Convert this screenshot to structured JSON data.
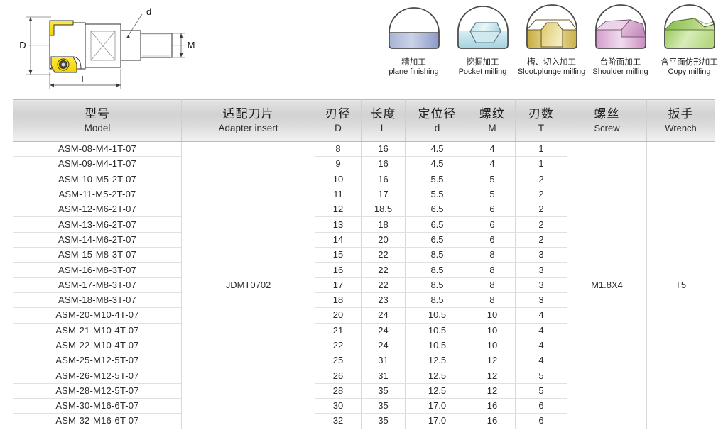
{
  "drawing": {
    "labels": {
      "diameter": "D",
      "length": "L",
      "pilot_diameter": "d",
      "thread": "M"
    }
  },
  "app_icons": [
    {
      "icon": "plane-finishing-icon",
      "label_cn": "精加工",
      "label_en": "plane finishing",
      "color": "#9aa7cf"
    },
    {
      "icon": "pocket-milling-icon",
      "label_cn": "挖掘加工",
      "label_en": "Pocket milling",
      "color": "#8fc6d9"
    },
    {
      "icon": "slot-plunge-milling-icon",
      "label_cn": "槽、切入加工",
      "label_en": "Sloot.plunge milling",
      "color": "#d3b445"
    },
    {
      "icon": "shoulder-milling-icon",
      "label_cn": "台阶面加工",
      "label_en": "Shoulder milling",
      "color": "#c98cc0"
    },
    {
      "icon": "copy-milling-icon",
      "label_cn": "含平面仿形加工",
      "label_en": "Copy milling",
      "color": "#9bc45a"
    }
  ],
  "table": {
    "headers": [
      {
        "cn": "型号",
        "en": "Model"
      },
      {
        "cn": "适配刀片",
        "en": "Adapter  insert"
      },
      {
        "cn": "刃径",
        "en": "D"
      },
      {
        "cn": "长度",
        "en": "L"
      },
      {
        "cn": "定位径",
        "en": "d"
      },
      {
        "cn": "螺纹",
        "en": "M"
      },
      {
        "cn": "刃数",
        "en": "T"
      },
      {
        "cn": "螺丝",
        "en": "Screw"
      },
      {
        "cn": "扳手",
        "en": "Wrench"
      }
    ],
    "merged": {
      "adapter_insert": "JDMT0702",
      "screw": "M1.8X4",
      "wrench": "T5"
    },
    "rows": [
      {
        "model": "ASM-08-M4-1T-07",
        "D": "8",
        "L": "16",
        "d": "4.5",
        "M": "4",
        "T": "1"
      },
      {
        "model": "ASM-09-M4-1T-07",
        "D": "9",
        "L": "16",
        "d": "4.5",
        "M": "4",
        "T": "1"
      },
      {
        "model": "ASM-10-M5-2T-07",
        "D": "10",
        "L": "16",
        "d": "5.5",
        "M": "5",
        "T": "2"
      },
      {
        "model": "ASM-11-M5-2T-07",
        "D": "11",
        "L": "17",
        "d": "5.5",
        "M": "5",
        "T": "2"
      },
      {
        "model": "ASM-12-M6-2T-07",
        "D": "12",
        "L": "18.5",
        "d": "6.5",
        "M": "6",
        "T": "2"
      },
      {
        "model": "ASM-13-M6-2T-07",
        "D": "13",
        "L": "18",
        "d": "6.5",
        "M": "6",
        "T": "2"
      },
      {
        "model": "ASM-14-M6-2T-07",
        "D": "14",
        "L": "20",
        "d": "6.5",
        "M": "6",
        "T": "2"
      },
      {
        "model": "ASM-15-M8-3T-07",
        "D": "15",
        "L": "22",
        "d": "8.5",
        "M": "8",
        "T": "3"
      },
      {
        "model": "ASM-16-M8-3T-07",
        "D": "16",
        "L": "22",
        "d": "8.5",
        "M": "8",
        "T": "3"
      },
      {
        "model": "ASM-17-M8-3T-07",
        "D": "17",
        "L": "22",
        "d": "8.5",
        "M": "8",
        "T": "3"
      },
      {
        "model": "ASM-18-M8-3T-07",
        "D": "18",
        "L": "23",
        "d": "8.5",
        "M": "8",
        "T": "3"
      },
      {
        "model": "ASM-20-M10-4T-07",
        "D": "20",
        "L": "24",
        "d": "10.5",
        "M": "10",
        "T": "4"
      },
      {
        "model": "ASM-21-M10-4T-07",
        "D": "21",
        "L": "24",
        "d": "10.5",
        "M": "10",
        "T": "4"
      },
      {
        "model": "ASM-22-M10-4T-07",
        "D": "22",
        "L": "24",
        "d": "10.5",
        "M": "10",
        "T": "4"
      },
      {
        "model": "ASM-25-M12-5T-07",
        "D": "25",
        "L": "31",
        "d": "12.5",
        "M": "12",
        "T": "4"
      },
      {
        "model": "ASM-26-M12-5T-07",
        "D": "26",
        "L": "31",
        "d": "12.5",
        "M": "12",
        "T": "5"
      },
      {
        "model": "ASM-28-M12-5T-07",
        "D": "28",
        "L": "35",
        "d": "12.5",
        "M": "12",
        "T": "5"
      },
      {
        "model": "ASM-30-M16-6T-07",
        "D": "30",
        "L": "35",
        "d": "17.0",
        "M": "16",
        "T": "6"
      },
      {
        "model": "ASM-32-M16-6T-07",
        "D": "32",
        "L": "35",
        "d": "17.0",
        "M": "16",
        "T": "6"
      }
    ]
  }
}
